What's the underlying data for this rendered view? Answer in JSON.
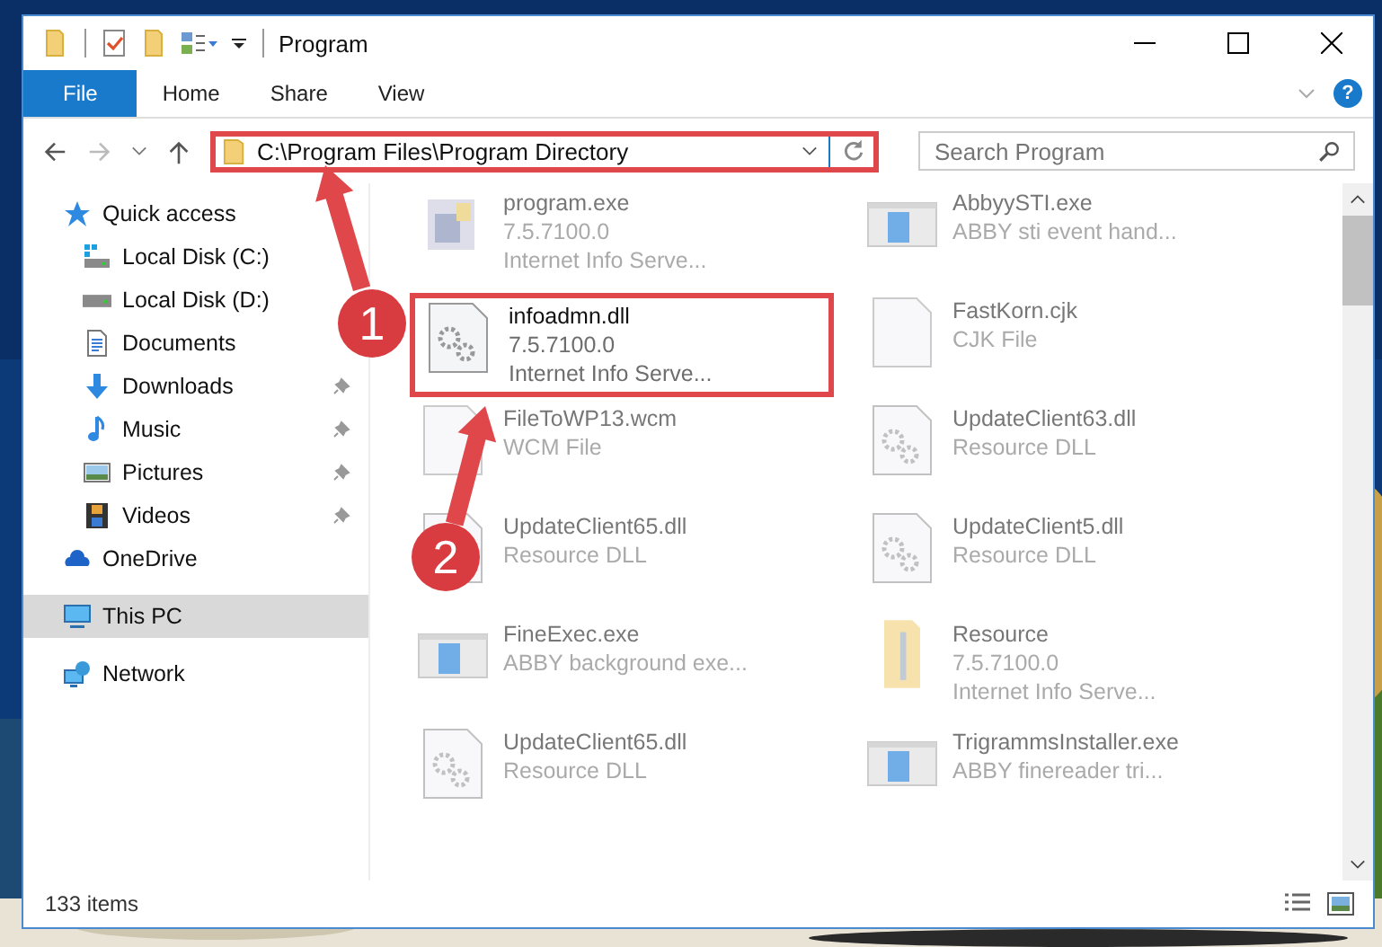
{
  "window": {
    "title": "Program"
  },
  "ribbon": {
    "tabs": [
      {
        "label": "File",
        "selected": true
      },
      {
        "label": "Home",
        "selected": false
      },
      {
        "label": "Share",
        "selected": false
      },
      {
        "label": "View",
        "selected": false
      }
    ],
    "help": "?"
  },
  "address_bar": {
    "path": "C:\\Program Files\\Program Directory",
    "highlighted": true
  },
  "search": {
    "placeholder": "Search Program"
  },
  "sidebar": [
    {
      "label": "Quick access",
      "kind": "star",
      "selected": false,
      "children": [
        {
          "label": "Local Disk (C:)",
          "kind": "systemdrive",
          "pinned": false,
          "selected": false
        },
        {
          "label": "Local Disk (D:)",
          "kind": "drive",
          "pinned": false,
          "selected": false
        },
        {
          "label": "Documents",
          "kind": "document",
          "pinned": false,
          "selected": false
        },
        {
          "label": "Downloads",
          "kind": "download",
          "pinned": true,
          "selected": false
        },
        {
          "label": "Music",
          "kind": "music",
          "pinned": true,
          "selected": false
        },
        {
          "label": "Pictures",
          "kind": "pictures",
          "pinned": true,
          "selected": false
        },
        {
          "label": "Videos",
          "kind": "videos",
          "pinned": true,
          "selected": false
        }
      ]
    },
    {
      "label": "OneDrive",
      "kind": "cloud",
      "selected": false
    },
    {
      "label": "This PC",
      "kind": "computer",
      "selected": true
    },
    {
      "label": "Network",
      "kind": "network",
      "selected": false
    }
  ],
  "files": [
    {
      "name": "program.exe",
      "kind": "installer",
      "details": [
        "7.5.7100.0",
        "Internet Info Serve..."
      ],
      "blurred": true,
      "highlighted": false
    },
    {
      "name": "AbbyySTI.exe",
      "kind": "application",
      "details": [
        "ABBY sti event hand..."
      ],
      "blurred": true,
      "highlighted": false
    },
    {
      "name": "infoadmn.dll",
      "kind": "library",
      "details": [
        "7.5.7100.0",
        "Internet Info Serve..."
      ],
      "blurred": false,
      "highlighted": true
    },
    {
      "name": "FastKorn.cjk",
      "kind": "file",
      "details": [
        "CJK File"
      ],
      "blurred": true,
      "highlighted": false
    },
    {
      "name": "FileToWP13.wcm",
      "kind": "file",
      "details": [
        "WCM File"
      ],
      "blurred": true,
      "highlighted": false
    },
    {
      "name": "UpdateClient63.dll",
      "kind": "library",
      "details": [
        "Resource DLL"
      ],
      "blurred": true,
      "highlighted": false
    },
    {
      "name": "UpdateClient65.dll",
      "kind": "library",
      "details": [
        "Resource DLL"
      ],
      "blurred": true,
      "highlighted": false
    },
    {
      "name": "UpdateClient5.dll",
      "kind": "library",
      "details": [
        "Resource DLL"
      ],
      "blurred": true,
      "highlighted": false
    },
    {
      "name": "FineExec.exe",
      "kind": "application",
      "details": [
        "ABBY background exe..."
      ],
      "blurred": true,
      "highlighted": false
    },
    {
      "name": "Resource",
      "kind": "folder",
      "details": [
        "7.5.7100.0",
        "Internet Info Serve..."
      ],
      "blurred": true,
      "highlighted": false
    },
    {
      "name": "UpdateClient65.dll",
      "kind": "library",
      "details": [
        "Resource DLL"
      ],
      "blurred": true,
      "highlighted": false
    },
    {
      "name": "TrigrammsInstaller.exe",
      "kind": "application",
      "details": [
        "ABBY finereader tri..."
      ],
      "blurred": true,
      "highlighted": false
    }
  ],
  "status_bar": {
    "item_count": "133 items"
  },
  "callouts": [
    {
      "number": "1"
    },
    {
      "number": "2"
    }
  ]
}
